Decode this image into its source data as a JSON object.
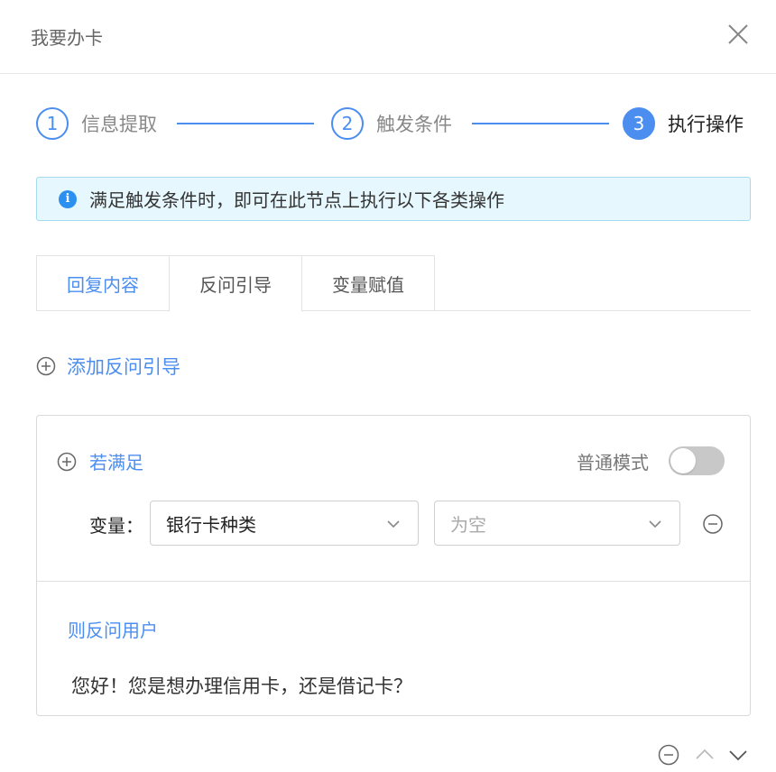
{
  "window": {
    "title": "我要办卡"
  },
  "steps": [
    {
      "number": "1",
      "label": "信息提取"
    },
    {
      "number": "2",
      "label": "触发条件"
    },
    {
      "number": "3",
      "label": "执行操作"
    }
  ],
  "info": {
    "icon": "info-icon",
    "glyph": "i",
    "text": "满足触发条件时，即可在此节点上执行以下各类操作"
  },
  "tabs": [
    {
      "label": "回复内容"
    },
    {
      "label": "反问引导"
    },
    {
      "label": "变量赋值"
    }
  ],
  "add_link": {
    "label": "添加反问引导"
  },
  "condition": {
    "satisfy_label": "若满足",
    "mode_label": "普通模式",
    "mode_enabled": false,
    "variable_label": "变量：",
    "variable_value": "银行卡种类",
    "operator_value": "为空",
    "then_label": "则反问用户",
    "reply_text": "您好！您是想办理信用卡，还是借记卡？"
  },
  "colors": {
    "accent": "#4b8ef0",
    "info_bg": "#e6f7fd",
    "info_border": "#a3dcf0",
    "toggle_off": "#c8c8c8"
  }
}
